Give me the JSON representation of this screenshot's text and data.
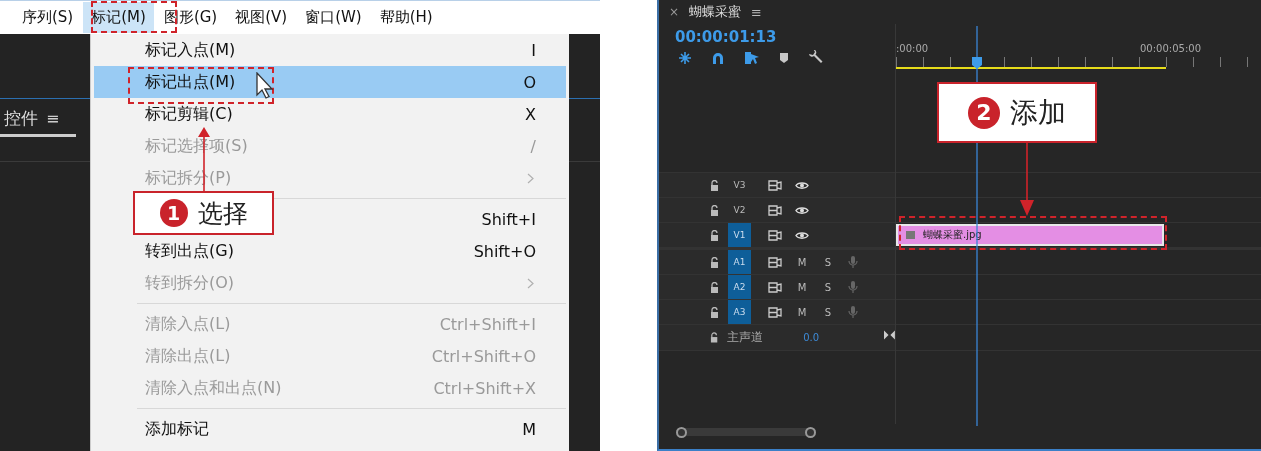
{
  "menu_bar": [
    {
      "label": "序列(S)",
      "selected": false
    },
    {
      "label": "标记(M)",
      "selected": true
    },
    {
      "label": "图形(G)",
      "selected": false
    },
    {
      "label": "视图(V)",
      "selected": false
    },
    {
      "label": "窗口(W)",
      "selected": false
    },
    {
      "label": "帮助(H)",
      "selected": false
    }
  ],
  "panel_tab": {
    "label": "控件",
    "menu": "≡"
  },
  "menu": [
    {
      "kind": "item",
      "label": "标记入点(M)",
      "shortcut": "I",
      "disabled": false,
      "selected": false
    },
    {
      "kind": "item",
      "label": "标记出点(M)",
      "shortcut": "O",
      "disabled": false,
      "selected": true
    },
    {
      "kind": "item",
      "label": "标记剪辑(C)",
      "shortcut": "X",
      "disabled": false,
      "selected": false
    },
    {
      "kind": "item",
      "label": "标记选择项(S)",
      "shortcut": "/",
      "disabled": true,
      "selected": false
    },
    {
      "kind": "submenu",
      "label": "标记拆分(P)",
      "disabled": true,
      "selected": false
    },
    {
      "kind": "separator"
    },
    {
      "kind": "item",
      "shortcut": "Shift+I",
      "disabled": false,
      "selected": false
    },
    {
      "kind": "item",
      "label": "转到出点(G)",
      "shortcut": "Shift+O",
      "disabled": false,
      "selected": false
    },
    {
      "kind": "submenu",
      "label": "转到拆分(O)",
      "disabled": true,
      "selected": false
    },
    {
      "kind": "separator"
    },
    {
      "kind": "item",
      "label": "清除入点(L)",
      "shortcut": "Ctrl+Shift+I",
      "disabled": true,
      "selected": false
    },
    {
      "kind": "item",
      "label": "清除出点(L)",
      "shortcut": "Ctrl+Shift+O",
      "disabled": true,
      "selected": false
    },
    {
      "kind": "item",
      "label": "清除入点和出点(N)",
      "shortcut": "Ctrl+Shift+X",
      "disabled": true,
      "selected": false
    },
    {
      "kind": "separator"
    },
    {
      "kind": "item",
      "label": "添加标记",
      "shortcut": "M",
      "disabled": false,
      "selected": false
    }
  ],
  "annotations": [
    {
      "number": "1",
      "text": "选择"
    },
    {
      "number": "2",
      "text": "添加"
    }
  ],
  "timeline": {
    "close": "×",
    "title": "蝴蝶采蜜",
    "menu": "≡",
    "timecode": "00:00:01:13",
    "ruler": [
      ":00:00",
      "00:00:05:00"
    ],
    "tracks": [
      {
        "kind": "video",
        "name": "V3",
        "targeted": false
      },
      {
        "kind": "video",
        "name": "V2",
        "targeted": false
      },
      {
        "kind": "video",
        "name": "V1",
        "targeted": true,
        "clip": "蝴蝶采蜜.jpg"
      },
      {
        "kind": "audio",
        "name": "A1",
        "targeted": true,
        "mute": "M",
        "solo": "S"
      },
      {
        "kind": "audio",
        "name": "A2",
        "targeted": true,
        "mute": "M",
        "solo": "S"
      },
      {
        "kind": "audio",
        "name": "A3",
        "targeted": true,
        "mute": "M",
        "solo": "S"
      },
      {
        "kind": "master",
        "name": "主声道",
        "value": "0.0"
      }
    ]
  }
}
